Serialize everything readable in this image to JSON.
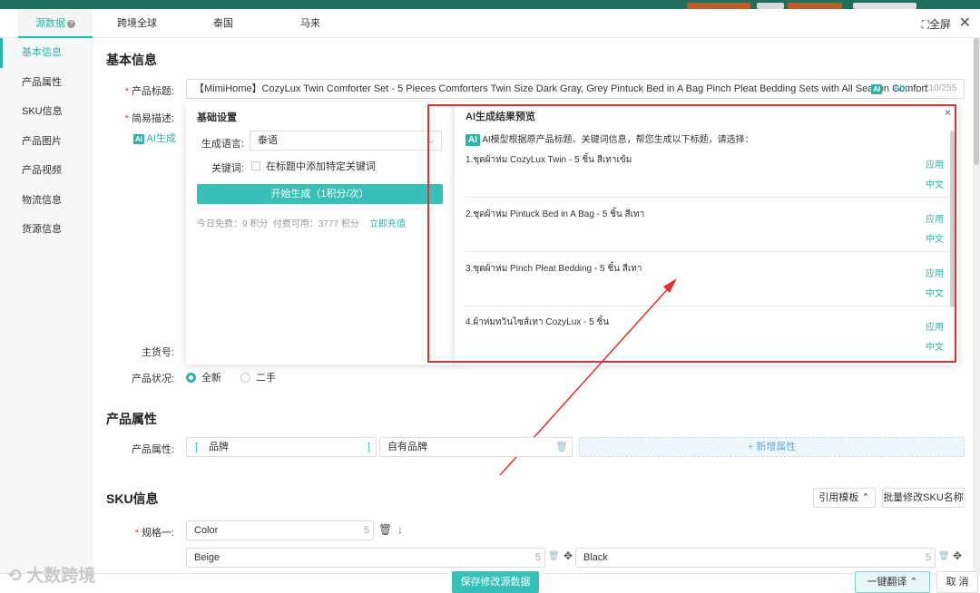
{
  "tabs": [
    "源数据",
    "跨境全球",
    "泰国",
    "马来"
  ],
  "header": {
    "fullscreen": "全屏"
  },
  "sidebar": [
    "基本信息",
    "产品属性",
    "SKU信息",
    "产品图片",
    "产品视频",
    "物流信息",
    "货源信息"
  ],
  "basic": {
    "title": "基本信息",
    "product_title_label": "产品标题:",
    "product_title_value": "【MimiHome】CozyLux Twin Comforter Set - 5 Pieces Comforters Twin Size Dark Gray, Grey Pintuck Bed in A Bag Pinch Pleat Bedding Sets with All Season Comfort",
    "abc": "Abc",
    "char_count": "210/255",
    "short_desc_label": "简易描述:",
    "ai_generate": "AI生成",
    "sku_no_label": "主货号:",
    "condition_label": "产品状况:",
    "condition_new": "全新",
    "condition_used": "二手"
  },
  "gen_panel": {
    "title": "基础设置",
    "lang_label": "生成语言:",
    "lang_value": "泰语",
    "keyword_label": "关键词:",
    "keyword_checkbox": "在标题中添加特定关键词",
    "start_button": "开始生成（1积分/次）",
    "free_today": "今日免费：9 积分",
    "paid_available": "付费可用：3777 积分",
    "recharge": "立即充值"
  },
  "result_panel": {
    "title": "AI生成结果预览",
    "ai_badge": "AI",
    "hint": "AI模型根据原产品标题、关键词信息，帮您生成以下标题，请选择：",
    "apply": "应用",
    "chinese": "中文",
    "results": [
      "1.ชุดผ้าห่ม CozyLux Twin - 5 ชิ้น สีเทาเข้ม",
      "2.ชุดผ้าห่ม Pintuck Bed in A Bag - 5 ชิ้น สีเทา",
      "3.ชุดผ้าห่ม Pinch Pleat Bedding - 5 ชิ้น สีเทา",
      "4.ผ้าห่มทวินไซส์เทา CozyLux - 5 ชิ้น"
    ]
  },
  "attributes": {
    "title": "产品属性",
    "label": "产品属性:",
    "bracket_left": "[",
    "bracket_right": "]",
    "name": "品牌",
    "value": "自有品牌",
    "add": "+ 新增属性"
  },
  "sku": {
    "title": "SKU信息",
    "template_button": "引用模板",
    "batch_button": "批量修改SKU名称",
    "spec_label": "规格一:",
    "spec_value": "Color",
    "spec_count": "5",
    "options": [
      "Beige",
      "Black"
    ],
    "option_counts": [
      "5",
      "5"
    ]
  },
  "footer": {
    "save": "保存修改源数据",
    "translate": "一键翻译",
    "cancel": "取 消",
    "watermark": "大数跨境"
  },
  "colors": {
    "accent": "#2bb3a8",
    "highlight": "#e03030"
  }
}
